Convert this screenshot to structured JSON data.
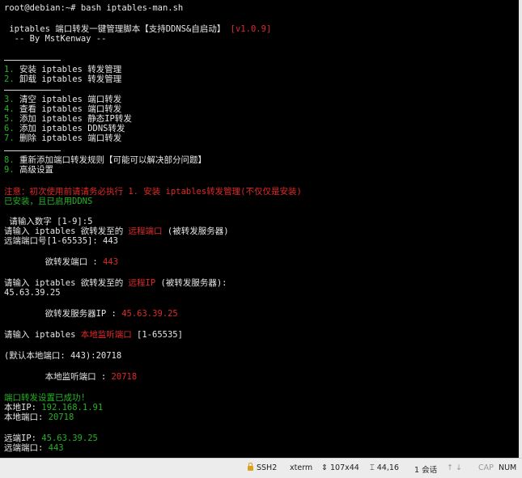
{
  "terminal": {
    "prompt_line": "root@debian:~# bash iptables-man.sh",
    "header": {
      "title": " iptables 端口转发一键管理脚本【支持DDNS&自启动】",
      "version": "[v1.0.9]",
      "author": "  -- By MstKenway --"
    },
    "menu": {
      "items": [
        {
          "num": "1.",
          "label": "安装 iptables 转发管理"
        },
        {
          "num": "2.",
          "label": "卸载 iptables 转发管理"
        },
        {
          "num": "3.",
          "label": "清空 iptables 端口转发"
        },
        {
          "num": "4.",
          "label": "查看 iptables 端口转发"
        },
        {
          "num": "5.",
          "label": "添加 iptables 静态IP转发"
        },
        {
          "num": "6.",
          "label": "添加 iptables DDNS转发"
        },
        {
          "num": "7.",
          "label": "删除 iptables 端口转发"
        },
        {
          "num": "8.",
          "label": "重新添加端口转发规则【可能可以解决部分问题】"
        },
        {
          "num": "9.",
          "label": "高级设置"
        }
      ]
    },
    "notice_red": "注意：初次使用前请请务必执行 1. 安装 iptables转发管理(不仅仅是安装)",
    "notice_green": "已安装，且已启用DDNS",
    "session": {
      "choice_prompt": " 请输入数字 [1-9]:5",
      "dest_port_prompt_a": "请输入 iptables 欲转发至的 ",
      "dest_port_prompt_red": "远程端口",
      "dest_port_prompt_b": " (被转发服务器)",
      "dest_port_input": "远端端口号[1-65535]: 443",
      "dest_port_label": "        欲转发端口 : ",
      "dest_port_value": "443",
      "dest_ip_prompt_a": "请输入 iptables 欲转发至的 ",
      "dest_ip_prompt_red": "远程IP",
      "dest_ip_prompt_b": " (被转发服务器):",
      "dest_ip_input": "45.63.39.25",
      "dest_ip_label": "        欲转发服务器IP : ",
      "dest_ip_value": "45.63.39.25",
      "local_port_prompt_a": "请输入 iptables ",
      "local_port_prompt_red": "本地监听端口",
      "local_port_prompt_b": " [1-65535]",
      "local_port_input": "(默认本地端口: 443):20718",
      "local_port_label": "        本地监听端口 : ",
      "local_port_value": "20718",
      "success": "端口转发设置已成功!",
      "local_ip_label": "本地IP: ",
      "local_ip_value": "192.168.1.91",
      "local_port_label2": "本地端口: ",
      "local_port_value2": "20718",
      "remote_ip_label": "远端IP: ",
      "remote_ip_value": "45.63.39.25",
      "remote_port_label": "远端端口: ",
      "remote_port_value": "443"
    }
  },
  "statusbar": {
    "ssh": "SSH2",
    "term": "xterm",
    "size": "107x44",
    "cursor": "44,16",
    "sessions": "1 会话",
    "cap": "CAP",
    "num": "NUM"
  },
  "colors": {
    "background": "#000000",
    "text": "#e6e6e6",
    "red": "#e02828",
    "green": "#24b324"
  }
}
